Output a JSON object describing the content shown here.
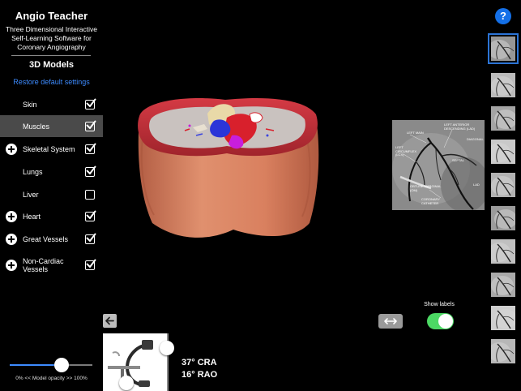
{
  "app": {
    "title": "Angio Teacher",
    "subtitle_lines": [
      "Three Dimensional Interactive",
      "Self-Learning Software for",
      "Coronary Angiography"
    ],
    "section_title": "3D Models",
    "restore_label": "Restore default settings"
  },
  "layers": [
    {
      "label": "Skin",
      "checked": true,
      "expandable": false,
      "selected": false
    },
    {
      "label": "Muscles",
      "checked": true,
      "expandable": false,
      "selected": true
    },
    {
      "label": "Skeletal System",
      "checked": true,
      "expandable": true,
      "selected": false
    },
    {
      "label": "Lungs",
      "checked": true,
      "expandable": false,
      "selected": false
    },
    {
      "label": "Liver",
      "checked": false,
      "expandable": false,
      "selected": false
    },
    {
      "label": "Heart",
      "checked": true,
      "expandable": true,
      "selected": false
    },
    {
      "label": "Great Vessels",
      "checked": true,
      "expandable": true,
      "selected": false
    },
    {
      "label": "Non-Cardiac Vessels",
      "checked": true,
      "expandable": true,
      "selected": false
    }
  ],
  "opacity": {
    "label": "0% << Model opacity >> 100%",
    "value_percent": 63
  },
  "angiogram": {
    "labels": [
      "LEFT MAIN",
      "LEFT ANTERIOR DESCENDING (LAD)",
      "DIAGONAL",
      "LEFT CIRCUMFLEX (LCX)",
      "SEPTAL",
      "OBTUSE MARGINAL (OM)",
      "CORONARY CATHETER",
      "LAD"
    ]
  },
  "view": {
    "show_labels_text": "Show labels",
    "show_labels_on": true,
    "angle_cra": "37° CRA",
    "angle_rao": "16° RAO"
  },
  "thumbnails": {
    "count": 11,
    "active_index": 0
  },
  "colors": {
    "accent": "#3d8bff",
    "toggle_on": "#4cd964",
    "help": "#1470e8",
    "thumb_border": "#2c74d6",
    "selected_row": "#4a4a4a"
  },
  "icons": {
    "help": "?",
    "back": "arrow-left-icon",
    "swap": "arrows-horizontal-icon",
    "expand": "plus-circle-icon",
    "check": "checkbox-check-icon"
  }
}
